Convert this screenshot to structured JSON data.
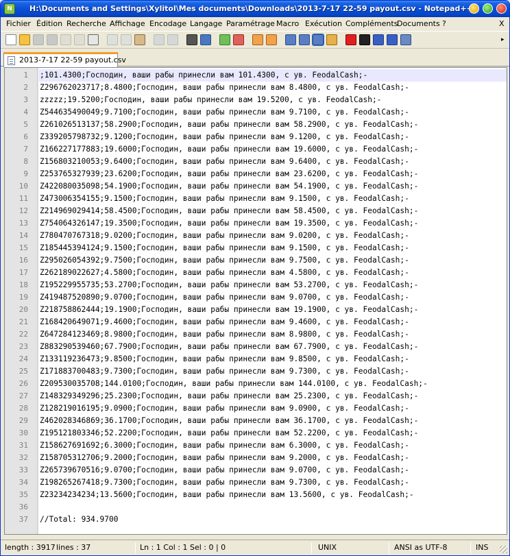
{
  "window": {
    "title": "H:\\Documents and Settings\\Xylitol\\Mes documents\\Downloads\\2013-7-17 22-59 payout.csv - Notepad++"
  },
  "menu": {
    "items": [
      "Fichier",
      "Édition",
      "Recherche",
      "Affichage",
      "Encodage",
      "Langage",
      "Paramétrage",
      "Macro",
      "Exécution",
      "Compléments",
      "Documents",
      "?"
    ],
    "close_label": "X"
  },
  "toolbar": {
    "icons": [
      {
        "name": "new-file-icon",
        "color": "#ffffff",
        "border": "#7a8aa3",
        "disabled": false
      },
      {
        "name": "open-file-icon",
        "color": "#f5c242",
        "border": "#b07d12",
        "disabled": false
      },
      {
        "name": "save-icon",
        "color": "#9aa3b0",
        "border": "#6c7480",
        "disabled": true
      },
      {
        "name": "save-all-icon",
        "color": "#9aa3b0",
        "border": "#6c7480",
        "disabled": true
      },
      {
        "name": "close-file-icon",
        "color": "#d0d0d0",
        "border": "#8a8a8a",
        "disabled": true
      },
      {
        "name": "close-all-icon",
        "color": "#d0d0d0",
        "border": "#8a8a8a",
        "disabled": true
      },
      {
        "name": "print-icon",
        "color": "#e6e6e6",
        "border": "#666666",
        "disabled": false
      },
      {
        "name": "cut-icon",
        "color": "#cfd6e0",
        "border": "#7d8796",
        "disabled": true
      },
      {
        "name": "copy-icon",
        "color": "#cfd6e0",
        "border": "#7d8796",
        "disabled": true
      },
      {
        "name": "paste-icon",
        "color": "#d8b98a",
        "border": "#8a6a3c",
        "disabled": false
      },
      {
        "name": "undo-icon",
        "color": "#b9c4d4",
        "border": "#7d8796",
        "disabled": true
      },
      {
        "name": "redo-icon",
        "color": "#b9c4d4",
        "border": "#7d8796",
        "disabled": true
      },
      {
        "name": "find-icon",
        "color": "#555555",
        "border": "#222222",
        "disabled": false
      },
      {
        "name": "replace-icon",
        "color": "#4a78c0",
        "border": "#234b88",
        "disabled": false
      },
      {
        "name": "zoom-in-icon",
        "color": "#6fbf5a",
        "border": "#3a7a2a",
        "disabled": false
      },
      {
        "name": "zoom-out-icon",
        "color": "#e0605a",
        "border": "#9a2a24",
        "disabled": false
      },
      {
        "name": "sync-vertical-icon",
        "color": "#f2a24a",
        "border": "#a0601a",
        "disabled": false
      },
      {
        "name": "sync-horizontal-icon",
        "color": "#f2a24a",
        "border": "#a0601a",
        "disabled": false
      },
      {
        "name": "word-wrap-icon",
        "color": "#5a7ec4",
        "border": "#2c4e8a",
        "disabled": false
      },
      {
        "name": "show-all-chars-icon",
        "color": "#5a7ec4",
        "border": "#2c4e8a",
        "disabled": false
      },
      {
        "name": "indent-guide-icon",
        "color": "#5a7ec4",
        "border": "#2c4e8a",
        "disabled": false
      },
      {
        "name": "language-icon",
        "color": "#e8b04a",
        "border": "#9a6a12",
        "disabled": false
      },
      {
        "name": "macro-record-icon",
        "color": "#e02020",
        "border": "#800000",
        "disabled": false
      },
      {
        "name": "macro-stop-icon",
        "color": "#222222",
        "border": "#000000",
        "disabled": false
      },
      {
        "name": "macro-play-icon",
        "color": "#3a5fc4",
        "border": "#1a3a88",
        "disabled": false
      },
      {
        "name": "macro-run-multiple-icon",
        "color": "#3a5fc4",
        "border": "#1a3a88",
        "disabled": false
      },
      {
        "name": "macro-save-icon",
        "color": "#6a8ac4",
        "border": "#2a4a88",
        "disabled": false
      }
    ]
  },
  "tabs": [
    {
      "label": "2013-7-17 22-59 payout.csv"
    }
  ],
  "editor": {
    "lines": [
      {
        "n": "1",
        "text": ";101.4300;Господин, ваши рабы принесли вам 101.4300, с ув. FeodalCash;-"
      },
      {
        "n": "2",
        "text": "Z296762023717;8.4800;Господин, ваши рабы принесли вам 8.4800, с ув. FeodalCash;-"
      },
      {
        "n": "3",
        "text": "zzzzz;19.5200;Господин, ваши рабы принесли вам 19.5200, с ув. FeodalCash;-"
      },
      {
        "n": "4",
        "text": "Z544635490049;9.7100;Господин, ваши рабы принесли вам 9.7100, с ув. FeodalCash;-"
      },
      {
        "n": "5",
        "text": "Z261026513137;58.2900;Господин, ваши рабы принесли вам 58.2900, с ув. FeodalCash;-"
      },
      {
        "n": "6",
        "text": "Z339205798732;9.1200;Господин, ваши рабы принесли вам 9.1200, с ув. FeodalCash;-"
      },
      {
        "n": "7",
        "text": "Z166227177883;19.6000;Господин, ваши рабы принесли вам 19.6000, с ув. FeodalCash;-"
      },
      {
        "n": "8",
        "text": "Z156803210053;9.6400;Господин, ваши рабы принесли вам 9.6400, с ув. FeodalCash;-"
      },
      {
        "n": "9",
        "text": "Z253765327939;23.6200;Господин, ваши рабы принесли вам 23.6200, с ув. FeodalCash;-"
      },
      {
        "n": "10",
        "text": "Z422080035098;54.1900;Господин, ваши рабы принесли вам 54.1900, с ув. FeodalCash;-"
      },
      {
        "n": "11",
        "text": "Z473006354155;9.1500;Господин, ваши рабы принесли вам 9.1500, с ув. FeodalCash;-"
      },
      {
        "n": "12",
        "text": "Z214969029414;58.4500;Господин, ваши рабы принесли вам 58.4500, с ув. FeodalCash;-"
      },
      {
        "n": "13",
        "text": "Z754064326147;19.3500;Господин, ваши рабы принесли вам 19.3500, с ув. FeodalCash;-"
      },
      {
        "n": "14",
        "text": "Z780470767318;9.0200;Господин, ваши рабы принесли вам 9.0200, с ув. FeodalCash;-"
      },
      {
        "n": "15",
        "text": "Z185445394124;9.1500;Господин, ваши рабы принесли вам 9.1500, с ув. FeodalCash;-"
      },
      {
        "n": "16",
        "text": "Z295026054392;9.7500;Господин, ваши рабы принесли вам 9.7500, с ув. FeodalCash;-"
      },
      {
        "n": "17",
        "text": "Z262189022627;4.5800;Господин, ваши рабы принесли вам 4.5800, с ув. FeodalCash;-"
      },
      {
        "n": "18",
        "text": "Z195229955735;53.2700;Господин, ваши рабы принесли вам 53.2700, с ув. FeodalCash;-"
      },
      {
        "n": "19",
        "text": "Z419487520890;9.0700;Господин, ваши рабы принесли вам 9.0700, с ув. FeodalCash;-"
      },
      {
        "n": "20",
        "text": "Z218758862444;19.1900;Господин, ваши рабы принесли вам 19.1900, с ув. FeodalCash;-"
      },
      {
        "n": "21",
        "text": "Z168420649071;9.4600;Господин, ваши рабы принесли вам 9.4600, с ув. FeodalCash;-"
      },
      {
        "n": "22",
        "text": "Z647284123469;8.9800;Господин, ваши рабы принесли вам 8.9800, с ув. FeodalCash;-"
      },
      {
        "n": "23",
        "text": "Z883290539460;67.7900;Господин, ваши рабы принесли вам 67.7900, с ув. FeodalCash;-"
      },
      {
        "n": "24",
        "text": "Z133119236473;9.8500;Господин, ваши рабы принесли вам 9.8500, с ув. FeodalCash;-"
      },
      {
        "n": "25",
        "text": "Z171883700483;9.7300;Господин, ваши рабы принесли вам 9.7300, с ув. FeodalCash;-"
      },
      {
        "n": "26",
        "text": "Z209530035708;144.0100;Господин, ваши рабы принесли вам 144.0100, с ув. FeodalCash;-"
      },
      {
        "n": "27",
        "text": "Z148329349296;25.2300;Господин, ваши рабы принесли вам 25.2300, с ув. FeodalCash;-"
      },
      {
        "n": "28",
        "text": "Z128219016195;9.0900;Господин, ваши рабы принесли вам 9.0900, с ув. FeodalCash;-"
      },
      {
        "n": "29",
        "text": "Z462028346869;36.1700;Господин, ваши рабы принесли вам 36.1700, с ув. FeodalCash;-"
      },
      {
        "n": "30",
        "text": "Z195121803346;52.2200;Господин, ваши рабы принесли вам 52.2200, с ув. FeodalCash;-"
      },
      {
        "n": "31",
        "text": "Z158627691692;6.3000;Господин, ваши рабы принесли вам 6.3000, с ув. FeodalCash;-"
      },
      {
        "n": "32",
        "text": "Z158705312706;9.2000;Господин, ваши рабы принесли вам 9.2000, с ув. FeodalCash;-"
      },
      {
        "n": "33",
        "text": "Z265739670516;9.0700;Господин, ваши рабы принесли вам 9.0700, с ув. FeodalCash;-"
      },
      {
        "n": "34",
        "text": "Z198265267418;9.7300;Господин, ваши рабы принесли вам 9.7300, с ув. FeodalCash;-"
      },
      {
        "n": "35",
        "text": "Z23234234234;13.5600;Господин, ваши рабы принесли вам 13.5600, с ув. FeodalCash;-"
      },
      {
        "n": "36",
        "text": ""
      },
      {
        "n": "37",
        "text": "//Total: 934.9700"
      }
    ]
  },
  "status": {
    "length": "length : 3917",
    "lines": "lines : 37",
    "position": "Ln : 1    Col : 1    Sel : 0 | 0",
    "eol": "UNIX",
    "encoding": "ANSI as UTF-8",
    "mode": "INS"
  }
}
